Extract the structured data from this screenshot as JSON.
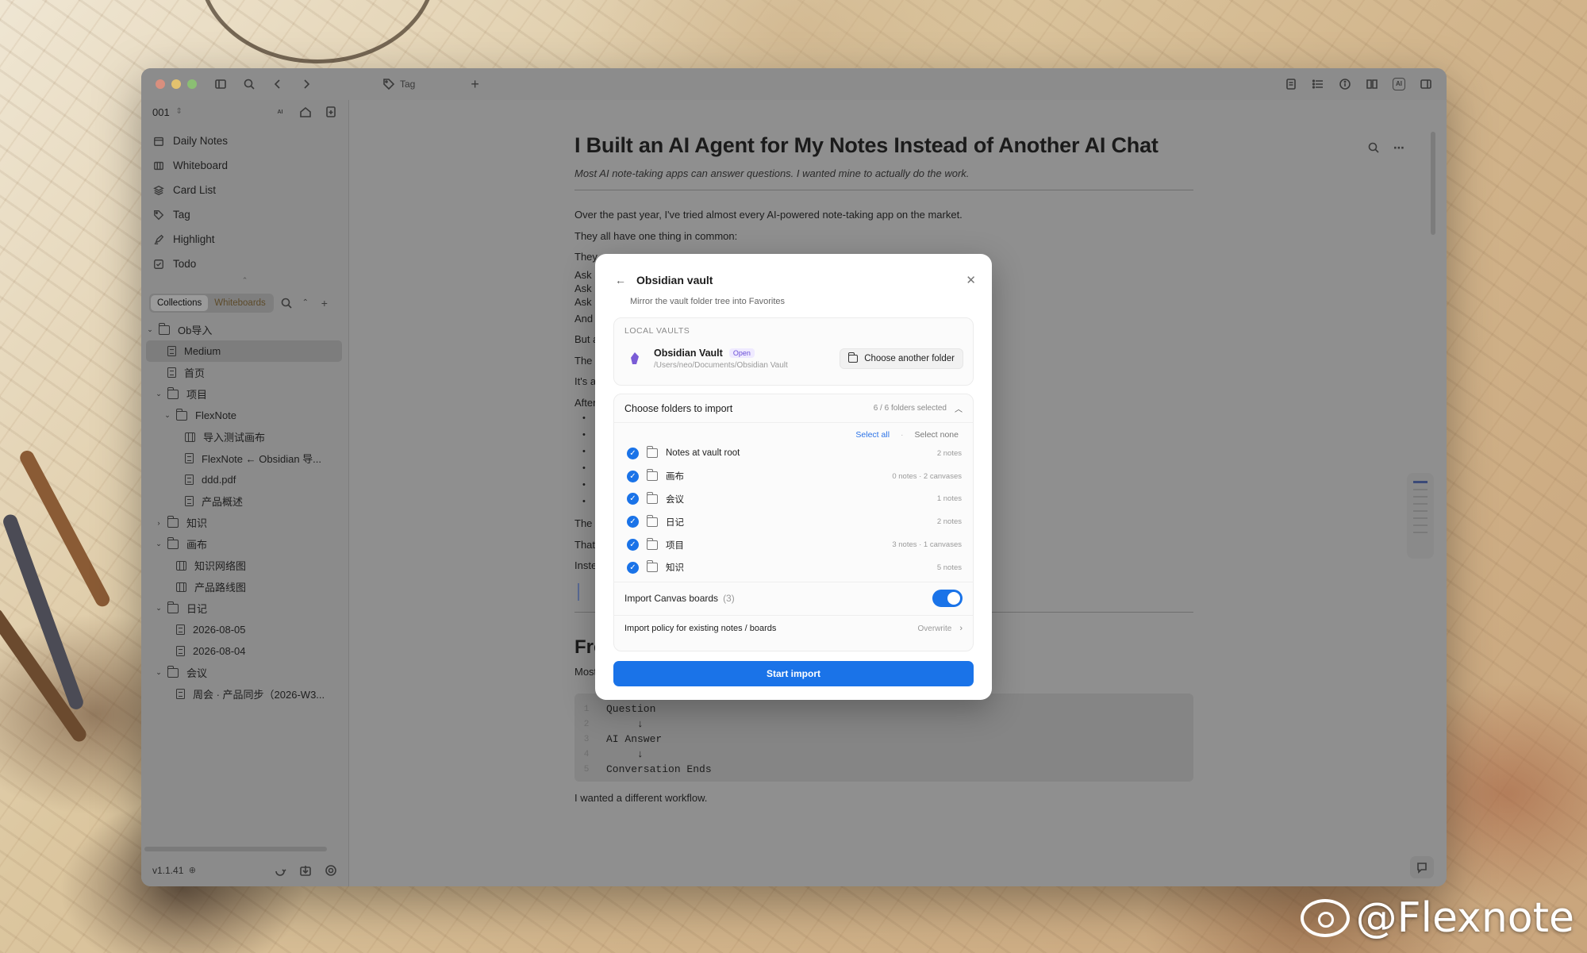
{
  "window": {
    "tab_label": "Tag",
    "traffic_colors": [
      "#d98f7e",
      "#e3c26e",
      "#8bbf73"
    ]
  },
  "sidebar": {
    "vault_name": "001",
    "ai_badge": "AI",
    "nav": [
      {
        "label": "Daily Notes",
        "icon": "calendar-icon"
      },
      {
        "label": "Whiteboard",
        "icon": "whiteboard-icon"
      },
      {
        "label": "Card List",
        "icon": "layers-icon"
      },
      {
        "label": "Tag",
        "icon": "tag-icon"
      },
      {
        "label": "Highlight",
        "icon": "highlighter-icon"
      },
      {
        "label": "Todo",
        "icon": "checkbox-icon"
      }
    ],
    "segments": {
      "collections": "Collections",
      "whiteboards": "Whiteboards"
    },
    "tree": [
      {
        "label": "Ob导入",
        "type": "folder",
        "depth": 0,
        "open": true
      },
      {
        "label": "Medium",
        "type": "file",
        "depth": 1,
        "selected": true
      },
      {
        "label": "首页",
        "type": "file",
        "depth": 1
      },
      {
        "label": "项目",
        "type": "folder",
        "depth": 1,
        "open": true
      },
      {
        "label": "FlexNote",
        "type": "folder",
        "depth": 2,
        "open": true
      },
      {
        "label": "导入测试画布",
        "type": "board",
        "depth": 3
      },
      {
        "label": "FlexNote ← Obsidian 导...",
        "type": "file",
        "depth": 3
      },
      {
        "label": "ddd.pdf",
        "type": "file",
        "depth": 3
      },
      {
        "label": "产品概述",
        "type": "file",
        "depth": 3
      },
      {
        "label": "知识",
        "type": "folder",
        "depth": 1,
        "open": false
      },
      {
        "label": "画布",
        "type": "folder",
        "depth": 1,
        "open": true
      },
      {
        "label": "知识网络图",
        "type": "board",
        "depth": 2
      },
      {
        "label": "产品路线图",
        "type": "board",
        "depth": 2
      },
      {
        "label": "日记",
        "type": "folder",
        "depth": 1,
        "open": true
      },
      {
        "label": "2026-08-05",
        "type": "file",
        "depth": 2
      },
      {
        "label": "2026-08-04",
        "type": "file",
        "depth": 2
      },
      {
        "label": "会议",
        "type": "folder",
        "depth": 1,
        "open": true
      },
      {
        "label": "周会 · 产品同步（2026-W3...",
        "type": "file",
        "depth": 2
      }
    ],
    "version": "v1.1.41"
  },
  "doc": {
    "title": "I Built an AI Agent for My Notes Instead of Another AI Chat",
    "subtitle": "Most AI note-taking apps can answer questions. I wanted mine to actually do the work.",
    "lines": [
      "Over the past year, I've tried almost every AI-powered note-taking app on the market.",
      "They all have one thing in common:",
      "They"
    ],
    "short_lines": [
      "Ask",
      "Ask",
      "Ask",
      "And",
      "But a",
      "The",
      "It's a",
      "After"
    ],
    "after_lines": [
      "The",
      "That",
      "Inste"
    ],
    "section_title": "From AI Chat to AI Agent",
    "section_intro": "Most AI features inside note-taking apps work like this:",
    "code": [
      {
        "n": "1",
        "t": "Question"
      },
      {
        "n": "2",
        "t": "     ↓"
      },
      {
        "n": "3",
        "t": "AI Answer"
      },
      {
        "n": "4",
        "t": "     ↓"
      },
      {
        "n": "5",
        "t": "Conversation Ends"
      }
    ],
    "closing": "I wanted a different workflow."
  },
  "modal": {
    "title": "Obsidian vault",
    "subtitle": "Mirror the vault folder tree into Favorites",
    "local_vaults_label": "LOCAL VAULTS",
    "vault_name": "Obsidian Vault",
    "vault_badge": "Open",
    "vault_path": "/Users/neo/Documents/Obsidian Vault",
    "choose_folder_label": "Choose another folder",
    "folders_title": "Choose folders to import",
    "folders_count": "6 / 6 folders selected",
    "select_all": "Select all",
    "select_none": "Select none",
    "folders": [
      {
        "name": "Notes at vault root",
        "meta": "2 notes"
      },
      {
        "name": "画布",
        "meta": "0 notes · 2 canvases"
      },
      {
        "name": "会议",
        "meta": "1 notes"
      },
      {
        "name": "日记",
        "meta": "2 notes"
      },
      {
        "name": "项目",
        "meta": "3 notes · 1 canvases"
      },
      {
        "name": "知识",
        "meta": "5 notes"
      }
    ],
    "canvas_label": "Import Canvas boards",
    "canvas_count": "(3)",
    "canvas_enabled": true,
    "policy_label": "Import policy for existing notes / boards",
    "policy_value": "Overwrite",
    "start_label": "Start import"
  },
  "watermark": "@Flexnote",
  "accent": "#1a73e8"
}
